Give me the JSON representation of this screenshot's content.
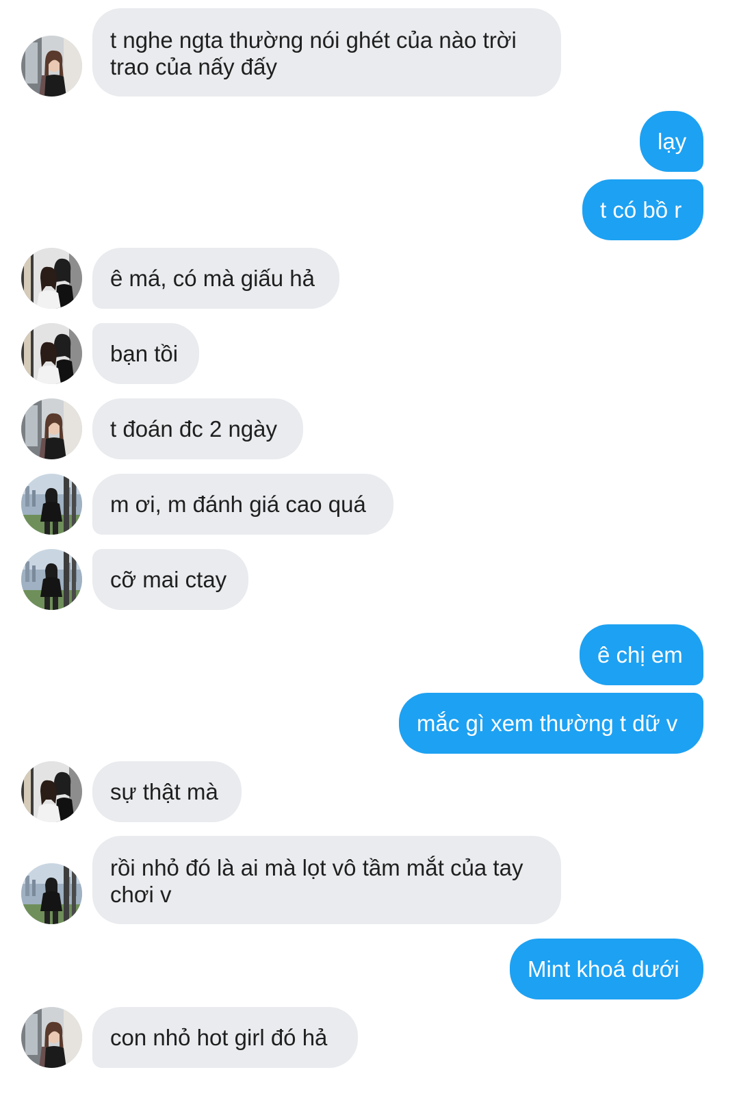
{
  "conversation": {
    "messages": [
      {
        "id": 1,
        "direction": "incoming",
        "avatar": "avatar-girl-mirror-icon",
        "text": "t nghe ngta thường nói ghét của nào trời trao của nấy đấy"
      },
      {
        "id": 2,
        "direction": "outgoing",
        "text": "lạy"
      },
      {
        "id": 3,
        "direction": "outgoing",
        "text": "t có bồ r"
      },
      {
        "id": 4,
        "direction": "incoming",
        "avatar": "avatar-two-girls-icon",
        "text": "ê má, có mà giấu hả"
      },
      {
        "id": 5,
        "direction": "incoming",
        "avatar": "avatar-two-girls-icon",
        "text": "bạn tồi"
      },
      {
        "id": 6,
        "direction": "incoming",
        "avatar": "avatar-girl-mirror-icon",
        "text": "t đoán đc 2 ngày"
      },
      {
        "id": 7,
        "direction": "incoming",
        "avatar": "avatar-city-girl-icon",
        "text": "m ơi, m đánh giá cao quá"
      },
      {
        "id": 8,
        "direction": "incoming",
        "avatar": "avatar-city-girl-icon",
        "text": "cỡ mai ctay"
      },
      {
        "id": 9,
        "direction": "outgoing",
        "text": "ê chị em"
      },
      {
        "id": 10,
        "direction": "outgoing",
        "text": "mắc gì xem thường t dữ v"
      },
      {
        "id": 11,
        "direction": "incoming",
        "avatar": "avatar-two-girls-icon",
        "text": "sự thật mà"
      },
      {
        "id": 12,
        "direction": "incoming",
        "avatar": "avatar-city-girl-icon",
        "text": "rồi nhỏ đó là ai mà lọt vô tầm mắt của tay chơi v"
      },
      {
        "id": 13,
        "direction": "outgoing",
        "text": "Mint khoá dưới"
      },
      {
        "id": 14,
        "direction": "incoming",
        "avatar": "avatar-girl-mirror-icon",
        "text": "con nhỏ hot girl đó hả"
      }
    ]
  },
  "colors": {
    "incoming_bubble": "#e9ebee",
    "outgoing_bubble": "#1da1f2",
    "incoming_text": "#1f1f1f",
    "outgoing_text": "#ffffff",
    "background": "#ffffff"
  }
}
